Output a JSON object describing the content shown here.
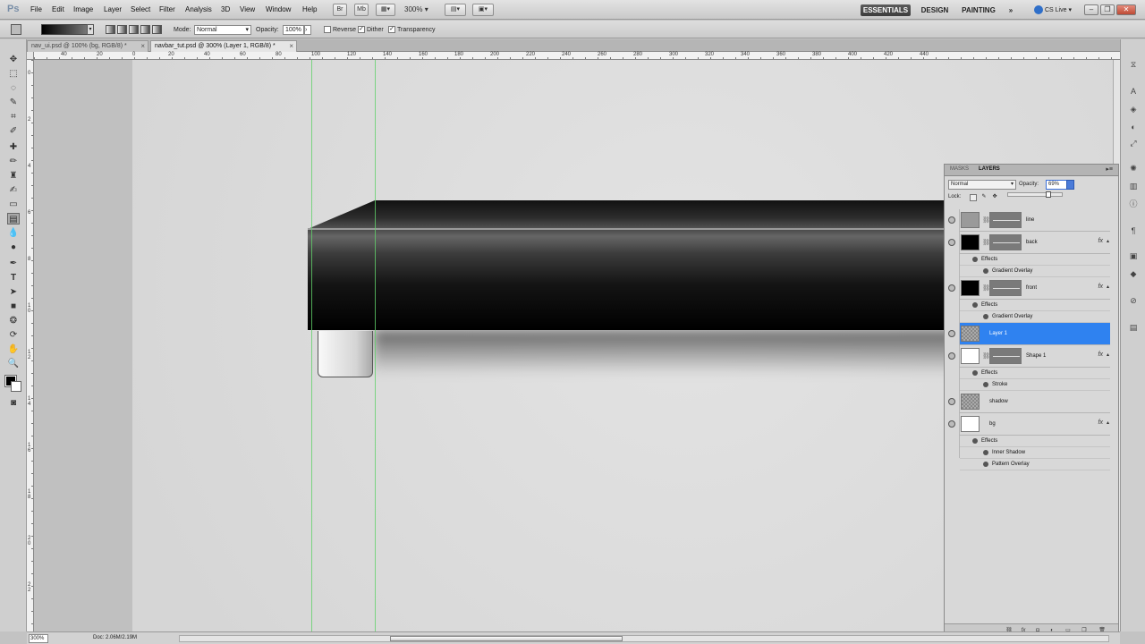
{
  "app": {
    "logo": "Ps",
    "menu": [
      "File",
      "Edit",
      "Image",
      "Layer",
      "Select",
      "Filter",
      "Analysis",
      "3D",
      "View",
      "Window",
      "Help"
    ],
    "zoom": "300%",
    "workspaces": [
      "ESSENTIALS",
      "DESIGN",
      "PAINTING"
    ],
    "more_workspaces": "»",
    "cs_live": "CS Live"
  },
  "options": {
    "mode_label": "Mode:",
    "mode_value": "Normal",
    "opacity_label": "Opacity:",
    "opacity_value": "100%",
    "reverse_label": "Reverse",
    "dither_label": "Dither",
    "transparency_label": "Transparency"
  },
  "tabs": [
    {
      "label": "nav_ui.psd @ 100% (bg, RGB/8) *"
    },
    {
      "label": "navbar_tut.psd @ 300% (Layer 1, RGB/8) *"
    }
  ],
  "ruler": {
    "h_labels": [
      "40",
      "20",
      "0",
      "20",
      "40",
      "60",
      "80",
      "100",
      "120",
      "140",
      "160",
      "180",
      "200",
      "220",
      "240",
      "260",
      "280",
      "300",
      "320",
      "340",
      "360",
      "380",
      "400",
      "420",
      "440"
    ],
    "v_labels": [
      "0",
      "2",
      "4",
      "6",
      "8",
      "10",
      "12",
      "14",
      "16",
      "18",
      "20",
      "22"
    ]
  },
  "layers_panel": {
    "tabs": [
      "MASKS",
      "LAYERS"
    ],
    "blend_mode": "Normal",
    "opacity_label": "Opacity:",
    "opacity_value": "69%",
    "opacity_slider_value": 0.69,
    "lock_label": "Lock:",
    "layers": [
      {
        "name": "line",
        "thumb": "grey",
        "has_mask": true,
        "fx": false,
        "effects": []
      },
      {
        "name": "back",
        "thumb": "black",
        "has_mask": true,
        "fx": true,
        "effects": [
          "Gradient Overlay"
        ]
      },
      {
        "name": "front",
        "thumb": "black",
        "has_mask": true,
        "fx": true,
        "effects": [
          "Gradient Overlay"
        ]
      },
      {
        "name": "Layer 1",
        "thumb": "checker",
        "has_mask": false,
        "fx": false,
        "selected": true,
        "effects": []
      },
      {
        "name": "Shape 1",
        "thumb": "white",
        "has_mask": true,
        "fx": true,
        "effects": [
          "Stroke"
        ]
      },
      {
        "name": "shadow",
        "thumb": "checker",
        "has_mask": false,
        "fx": false,
        "effects": []
      },
      {
        "name": "bg",
        "thumb": "white",
        "has_mask": false,
        "fx": true,
        "effects": [
          "Inner Shadow",
          "Pattern Overlay"
        ]
      }
    ],
    "effects_label": "Effects",
    "fx_label": "fx"
  },
  "status": {
    "zoom": "300%",
    "doc_info": "Doc: 2.06M/2.19M"
  },
  "colors": {
    "selection": "#2f82f0",
    "guide": "#62d16a"
  }
}
